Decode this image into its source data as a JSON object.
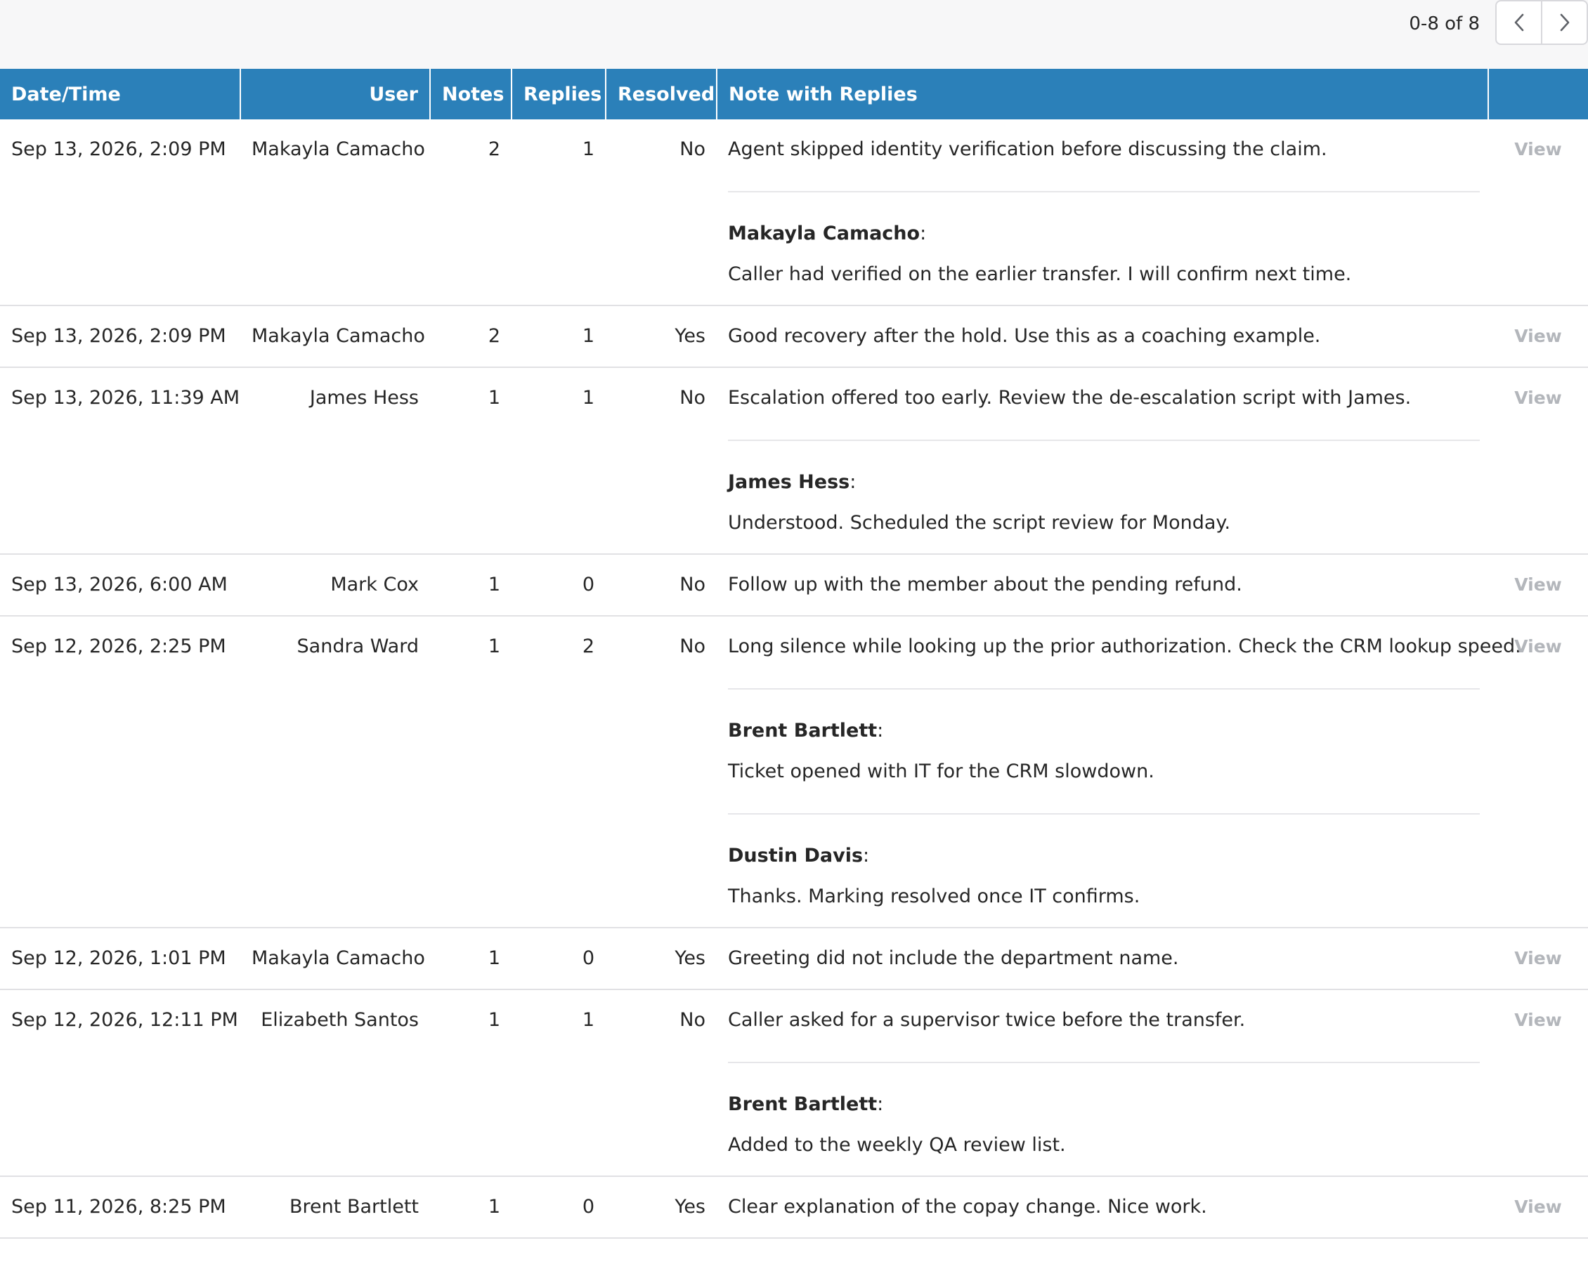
{
  "pager": {
    "range_text": "0-8 of 8",
    "prev_icon": "chevron-left-icon",
    "next_icon": "chevron-right-icon"
  },
  "table": {
    "headers": {
      "datetime": "Date/Time",
      "user": "User",
      "notes": "Notes",
      "replies": "Replies",
      "resolved": "Resolved",
      "note_with_replies": "Note with Replies",
      "action": ""
    },
    "view_label": "View",
    "rows": [
      {
        "datetime": "Sep 13, 2026, 2:09 PM",
        "user": "Makayla Camacho",
        "notes": "2",
        "replies_count": "1",
        "resolved": "No",
        "note": "Agent skipped identity verification before discussing the claim.",
        "replies": [
          {
            "author": "Makayla Camacho",
            "text": "Caller had verified on the earlier transfer. I will confirm next time."
          }
        ]
      },
      {
        "datetime": "Sep 13, 2026, 2:09 PM",
        "user": "Makayla Camacho",
        "notes": "2",
        "replies_count": "1",
        "resolved": "Yes",
        "note": "Good recovery after the hold. Use this as a coaching example.",
        "replies": []
      },
      {
        "datetime": "Sep 13, 2026, 11:39 AM",
        "user": "James Hess",
        "notes": "1",
        "replies_count": "1",
        "resolved": "No",
        "note": "Escalation offered too early. Review the de-escalation script with James.",
        "replies": [
          {
            "author": "James Hess",
            "text": "Understood. Scheduled the script review for Monday."
          }
        ]
      },
      {
        "datetime": "Sep 13, 2026, 6:00 AM",
        "user": "Mark Cox",
        "notes": "1",
        "replies_count": "0",
        "resolved": "No",
        "note": "Follow up with the member about the pending refund.",
        "replies": []
      },
      {
        "datetime": "Sep 12, 2026, 2:25 PM",
        "user": "Sandra Ward",
        "notes": "1",
        "replies_count": "2",
        "resolved": "No",
        "note": "Long silence while looking up the prior authorization. Check the CRM lookup speed.",
        "replies": [
          {
            "author": "Brent Bartlett",
            "text": "Ticket opened with IT for the CRM slowdown."
          },
          {
            "author": "Dustin Davis",
            "text": "Thanks. Marking resolved once IT confirms."
          }
        ]
      },
      {
        "datetime": "Sep 12, 2026, 1:01 PM",
        "user": "Makayla Camacho",
        "notes": "1",
        "replies_count": "0",
        "resolved": "Yes",
        "note": "Greeting did not include the department name.",
        "replies": []
      },
      {
        "datetime": "Sep 12, 2026, 12:11 PM",
        "user": "Elizabeth Santos",
        "notes": "1",
        "replies_count": "1",
        "resolved": "No",
        "note": "Caller asked for a supervisor twice before the transfer.",
        "replies": [
          {
            "author": "Brent Bartlett",
            "text": "Added to the weekly QA review list."
          }
        ]
      },
      {
        "datetime": "Sep 11, 2026, 8:25 PM",
        "user": "Brent Bartlett",
        "notes": "1",
        "replies_count": "0",
        "resolved": "Yes",
        "note": "Clear explanation of the copay change. Nice work.",
        "replies": []
      }
    ]
  },
  "colors": {
    "header_bg": "#2b80b9",
    "header_text": "#ffffff",
    "view_link": "#b3b6bb",
    "topbar_bg": "#f7f7f8"
  }
}
